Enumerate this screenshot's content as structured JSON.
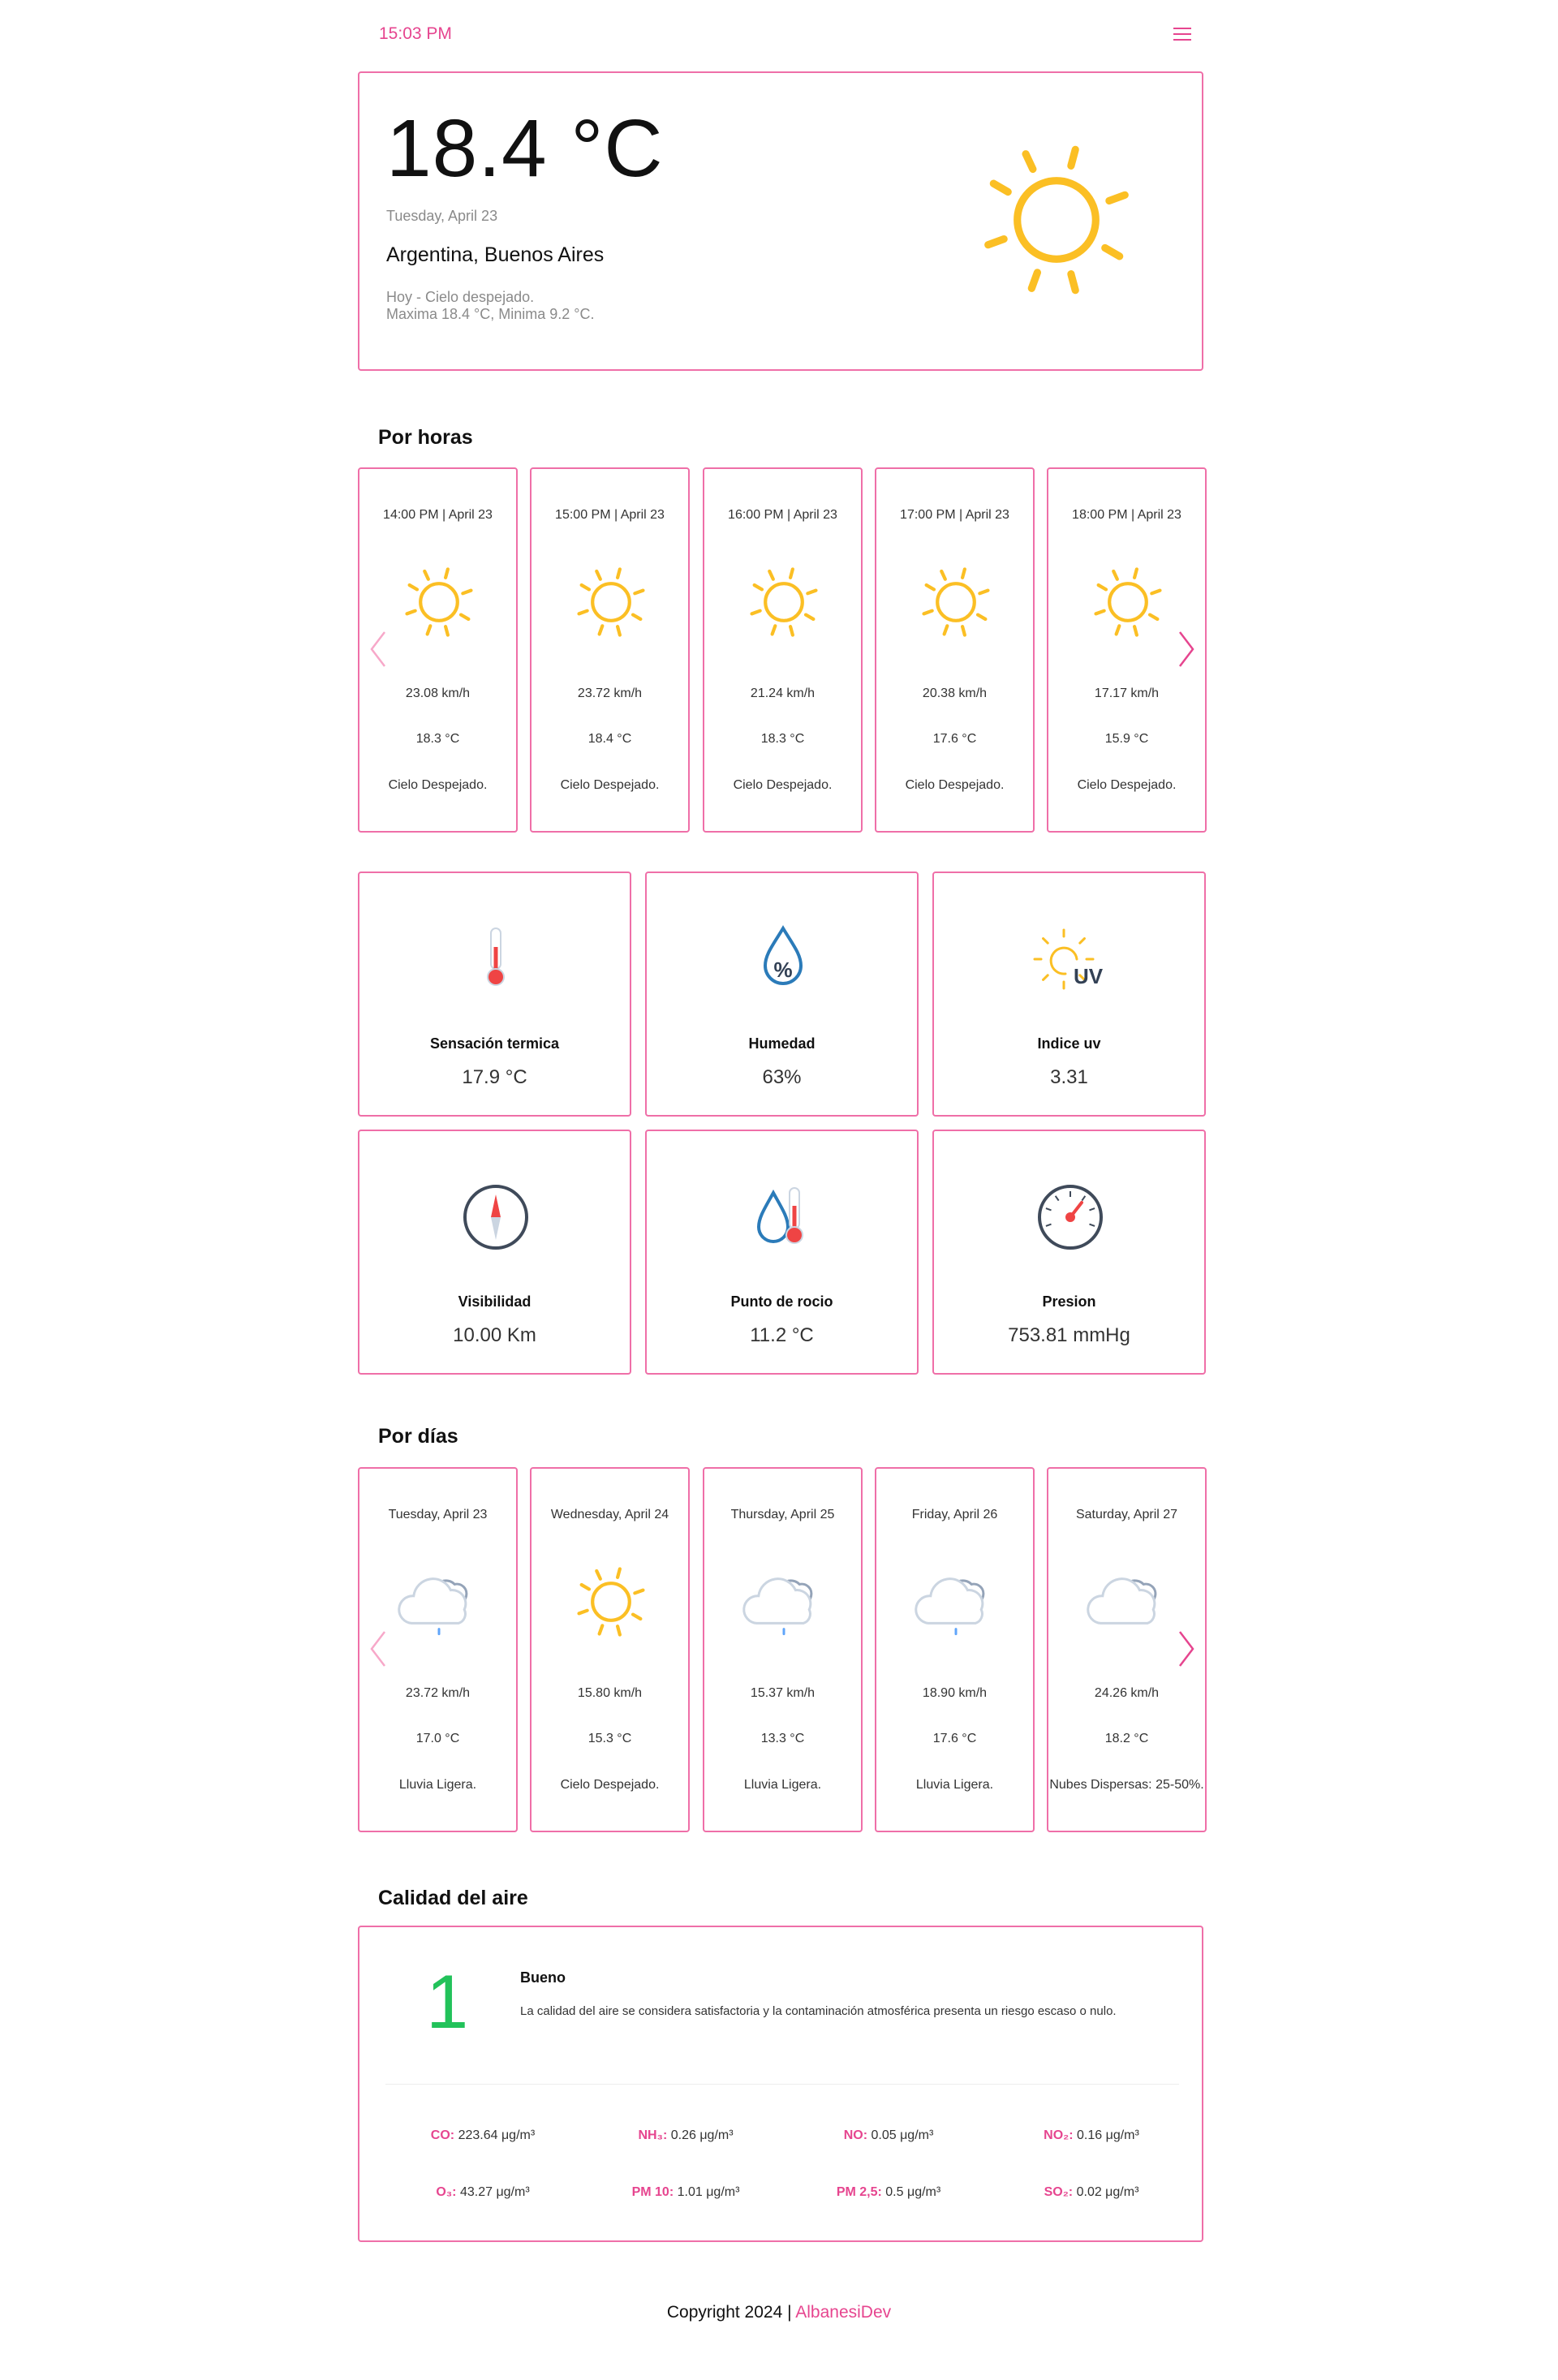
{
  "header": {
    "time": "15:03 PM",
    "menu_icon": "hamburger-menu-icon"
  },
  "current": {
    "temperature": "18.4 °C",
    "date": "Tuesday, April 23",
    "location": "Argentina, Buenos Aires",
    "summary_line1": "Hoy - Cielo despejado.",
    "summary_line2": "Maxima 18.4 °C, Minima 9.2 °C.",
    "icon": "sun-icon"
  },
  "hourly": {
    "title": "Por horas",
    "items": [
      {
        "label": "14:00 PM | April 23",
        "icon": "sun-icon",
        "wind": "23.08 km/h",
        "temp": "18.3 °C",
        "desc": "Cielo Despejado."
      },
      {
        "label": "15:00 PM | April 23",
        "icon": "sun-icon",
        "wind": "23.72 km/h",
        "temp": "18.4 °C",
        "desc": "Cielo Despejado."
      },
      {
        "label": "16:00 PM | April 23",
        "icon": "sun-icon",
        "wind": "21.24 km/h",
        "temp": "18.3 °C",
        "desc": "Cielo Despejado."
      },
      {
        "label": "17:00 PM | April 23",
        "icon": "sun-icon",
        "wind": "20.38 km/h",
        "temp": "17.6 °C",
        "desc": "Cielo Despejado."
      },
      {
        "label": "18:00 PM | April 23",
        "icon": "sun-icon",
        "wind": "17.17 km/h",
        "temp": "15.9 °C",
        "desc": "Cielo Despejado."
      }
    ]
  },
  "stats": [
    {
      "title": "Sensación termica",
      "value": "17.9 °C",
      "icon": "thermometer-icon"
    },
    {
      "title": "Humedad",
      "value": "63%",
      "icon": "humidity-drop-icon"
    },
    {
      "title": "Indice uv",
      "value": "3.31",
      "icon": "uv-sun-icon",
      "icon_text": "UV"
    },
    {
      "title": "Visibilidad",
      "value": "10.00 Km",
      "icon": "compass-icon"
    },
    {
      "title": "Punto de rocio",
      "value": "11.2 °C",
      "icon": "dew-point-icon"
    },
    {
      "title": "Presion",
      "value": "753.81 mmHg",
      "icon": "barometer-icon"
    }
  ],
  "daily": {
    "title": "Por días",
    "items": [
      {
        "label": "Tuesday, April 23",
        "icon": "rain-cloud-icon",
        "wind": "23.72 km/h",
        "temp": "17.0 °C",
        "desc": "Lluvia Ligera."
      },
      {
        "label": "Wednesday, April 24",
        "icon": "sun-icon",
        "wind": "15.80 km/h",
        "temp": "15.3 °C",
        "desc": "Cielo Despejado."
      },
      {
        "label": "Thursday, April 25",
        "icon": "rain-cloud-icon",
        "wind": "15.37 km/h",
        "temp": "13.3 °C",
        "desc": "Lluvia Ligera."
      },
      {
        "label": "Friday, April 26",
        "icon": "rain-cloud-icon",
        "wind": "18.90 km/h",
        "temp": "17.6 °C",
        "desc": "Lluvia Ligera."
      },
      {
        "label": "Saturday, April 27",
        "icon": "cloud-icon",
        "wind": "24.26 km/h",
        "temp": "18.2 °C",
        "desc": "Nubes Dispersas: 25-50%."
      }
    ]
  },
  "air": {
    "title": "Calidad del aire",
    "index": "1",
    "status": "Bueno",
    "description": "La calidad del aire se considera satisfactoria y la contaminación atmosférica presenta un riesgo escaso o nulo.",
    "pollutants": [
      {
        "name": "CO:",
        "value": "223.64 μg/m³"
      },
      {
        "name": "NH₃:",
        "value": "0.26 μg/m³"
      },
      {
        "name": "NO:",
        "value": "0.05 μg/m³"
      },
      {
        "name": "NO₂:",
        "value": "0.16 μg/m³"
      },
      {
        "name": "O₃:",
        "value": "43.27 μg/m³"
      },
      {
        "name": "PM 10:",
        "value": "1.01 μg/m³"
      },
      {
        "name": "PM 2,5:",
        "value": "0.5 μg/m³"
      },
      {
        "name": "SO₂:",
        "value": "0.02 μg/m³"
      }
    ]
  },
  "footer": {
    "text": "Copyright 2024 | ",
    "link": "AlbanesiDev"
  },
  "colors": {
    "accent": "#e6458f",
    "sun": "#fbbf24",
    "aqi_good": "#22c25a"
  }
}
